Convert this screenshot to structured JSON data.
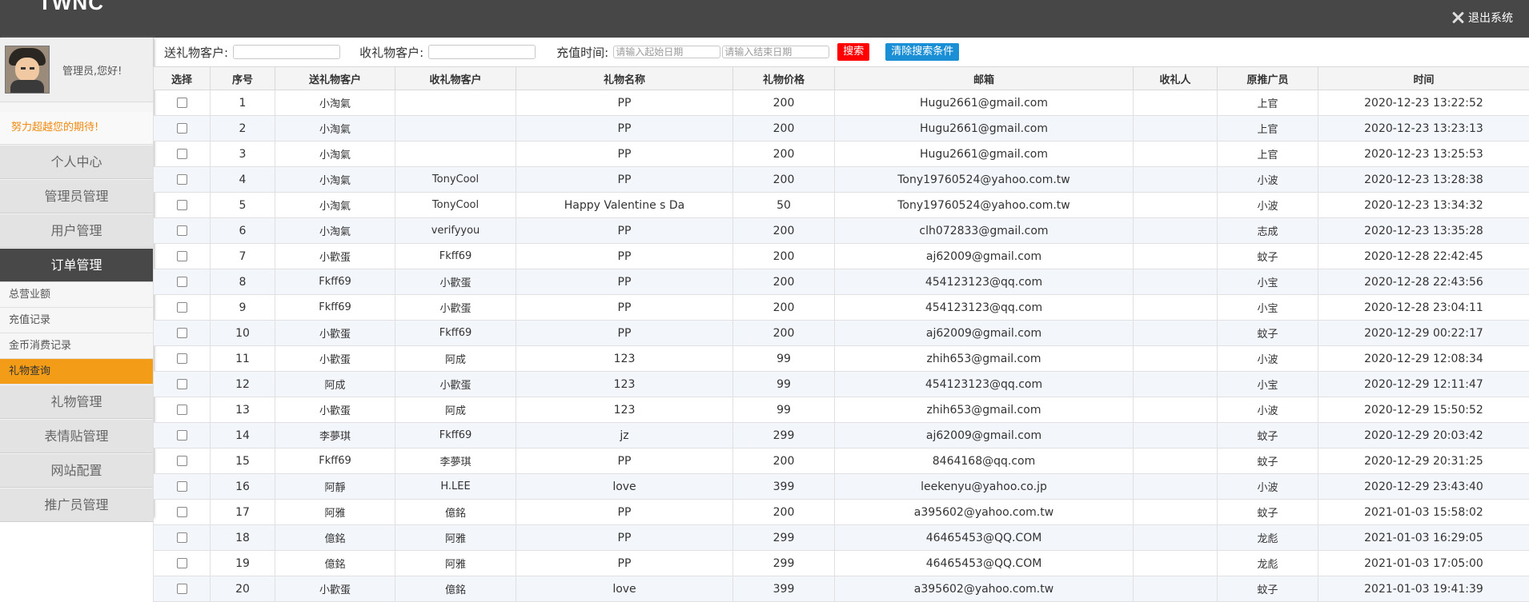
{
  "header": {
    "logo": "TWNC",
    "logout_label": "退出系统"
  },
  "sidebar": {
    "greeting": "管理员,您好!",
    "motto": "努力超越您的期待!",
    "menu_before": [
      "个人中心",
      "管理员管理",
      "用户管理"
    ],
    "active_menu": "订单管理",
    "submenu": [
      "总营业额",
      "充值记录",
      "金币消费记录",
      "礼物查询"
    ],
    "active_submenu": "礼物查询",
    "menu_after": [
      "礼物管理",
      "表情贴管理",
      "网站配置",
      "推广员管理"
    ],
    "accent_color": "#f39c17"
  },
  "search": {
    "sender_label": "送礼物客户:",
    "receiver_label": "收礼物客户:",
    "time_label": "充值时间:",
    "start_placeholder": "请输入起始日期",
    "end_placeholder": "请输入结束日期",
    "search_button": "搜索",
    "clear_button": "清除搜索条件"
  },
  "table": {
    "columns": [
      "选择",
      "序号",
      "送礼物客户",
      "收礼物客户",
      "礼物名称",
      "礼物价格",
      "邮箱",
      "收礼人",
      "原推广员",
      "时间"
    ],
    "rows": [
      [
        "1",
        "小淘氣",
        "",
        "PP",
        "200",
        "Hugu2661@gmail.com",
        "",
        "上官",
        "2020-12-23 13:22:52"
      ],
      [
        "2",
        "小淘氣",
        "",
        "PP",
        "200",
        "Hugu2661@gmail.com",
        "",
        "上官",
        "2020-12-23 13:23:13"
      ],
      [
        "3",
        "小淘氣",
        "",
        "PP",
        "200",
        "Hugu2661@gmail.com",
        "",
        "上官",
        "2020-12-23 13:25:53"
      ],
      [
        "4",
        "小淘氣",
        "TonyCool",
        "PP",
        "200",
        "Tony19760524@yahoo.com.tw",
        "",
        "小波",
        "2020-12-23 13:28:38"
      ],
      [
        "5",
        "小淘氣",
        "TonyCool",
        "Happy Valentine s Da",
        "50",
        "Tony19760524@yahoo.com.tw",
        "",
        "小波",
        "2020-12-23 13:34:32"
      ],
      [
        "6",
        "小淘氣",
        "verifyyou",
        "PP",
        "200",
        "clh072833@gmail.com",
        "",
        "志成",
        "2020-12-23 13:35:28"
      ],
      [
        "7",
        "小歡蛋",
        "Fkff69",
        "PP",
        "200",
        "aj62009@gmail.com",
        "",
        "蚊子",
        "2020-12-28 22:42:45"
      ],
      [
        "8",
        "Fkff69",
        "小歡蛋",
        "PP",
        "200",
        "454123123@qq.com",
        "",
        "小宝",
        "2020-12-28 22:43:56"
      ],
      [
        "9",
        "Fkff69",
        "小歡蛋",
        "PP",
        "200",
        "454123123@qq.com",
        "",
        "小宝",
        "2020-12-28 23:04:11"
      ],
      [
        "10",
        "小歡蛋",
        "Fkff69",
        "PP",
        "200",
        "aj62009@gmail.com",
        "",
        "蚊子",
        "2020-12-29 00:22:17"
      ],
      [
        "11",
        "小歡蛋",
        "阿成",
        "123",
        "99",
        "zhih653@gmail.com",
        "",
        "小波",
        "2020-12-29 12:08:34"
      ],
      [
        "12",
        "阿成",
        "小歡蛋",
        "123",
        "99",
        "454123123@qq.com",
        "",
        "小宝",
        "2020-12-29 12:11:47"
      ],
      [
        "13",
        "小歡蛋",
        "阿成",
        "123",
        "99",
        "zhih653@gmail.com",
        "",
        "小波",
        "2020-12-29 15:50:52"
      ],
      [
        "14",
        "李夢琪",
        "Fkff69",
        "jz",
        "299",
        "aj62009@gmail.com",
        "",
        "蚊子",
        "2020-12-29 20:03:42"
      ],
      [
        "15",
        "Fkff69",
        "李夢琪",
        "PP",
        "200",
        "8464168@qq.com",
        "",
        "蚊子",
        "2020-12-29 20:31:25"
      ],
      [
        "16",
        "阿靜",
        "H.LEE",
        "love",
        "399",
        "leekenyu@yahoo.co.jp",
        "",
        "小波",
        "2020-12-29 23:43:40"
      ],
      [
        "17",
        "阿雅",
        "億銘",
        "PP",
        "200",
        "a395602@yahoo.com.tw",
        "",
        "蚊子",
        "2021-01-03 15:58:02"
      ],
      [
        "18",
        "億銘",
        "阿雅",
        "PP",
        "299",
        "46465453@QQ.COM",
        "",
        "龙彪",
        "2021-01-03 16:29:05"
      ],
      [
        "19",
        "億銘",
        "阿雅",
        "PP",
        "299",
        "46465453@QQ.COM",
        "",
        "龙彪",
        "2021-01-03 17:05:00"
      ],
      [
        "20",
        "小歡蛋",
        "億銘",
        "love",
        "399",
        "a395602@yahoo.com.tw",
        "",
        "蚊子",
        "2021-01-03 19:41:39"
      ]
    ]
  }
}
